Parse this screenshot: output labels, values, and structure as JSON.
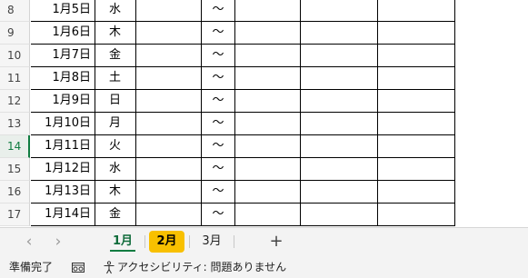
{
  "sheet": {
    "rows": [
      {
        "num": "8",
        "date": "1月5日",
        "dow": "水",
        "sep": "～"
      },
      {
        "num": "9",
        "date": "1月6日",
        "dow": "木",
        "sep": "～"
      },
      {
        "num": "10",
        "date": "1月7日",
        "dow": "金",
        "sep": "～"
      },
      {
        "num": "11",
        "date": "1月8日",
        "dow": "土",
        "sep": "～"
      },
      {
        "num": "12",
        "date": "1月9日",
        "dow": "日",
        "sep": "～"
      },
      {
        "num": "13",
        "date": "1月10日",
        "dow": "月",
        "sep": "～"
      },
      {
        "num": "14",
        "date": "1月11日",
        "dow": "火",
        "sep": "～"
      },
      {
        "num": "15",
        "date": "1月12日",
        "dow": "水",
        "sep": "～"
      },
      {
        "num": "16",
        "date": "1月13日",
        "dow": "木",
        "sep": "～"
      },
      {
        "num": "17",
        "date": "1月14日",
        "dow": "金",
        "sep": "～"
      }
    ],
    "selected_row": "14"
  },
  "tabs": {
    "prev_icon": "‹",
    "next_icon": "›",
    "items": [
      {
        "label": "1月",
        "state": "active"
      },
      {
        "label": "2月",
        "state": "highlighted",
        "color": "#f8c000"
      },
      {
        "label": "3月",
        "state": "normal"
      }
    ],
    "add_icon": "+"
  },
  "status": {
    "ready": "準備完了",
    "macro_icon": "macro-record-icon",
    "accessibility_icon": "accessibility-icon",
    "accessibility": "アクセシビリティ: 問題ありません"
  },
  "colors": {
    "accent": "#107c41",
    "tab_highlight": "#f8c000"
  }
}
